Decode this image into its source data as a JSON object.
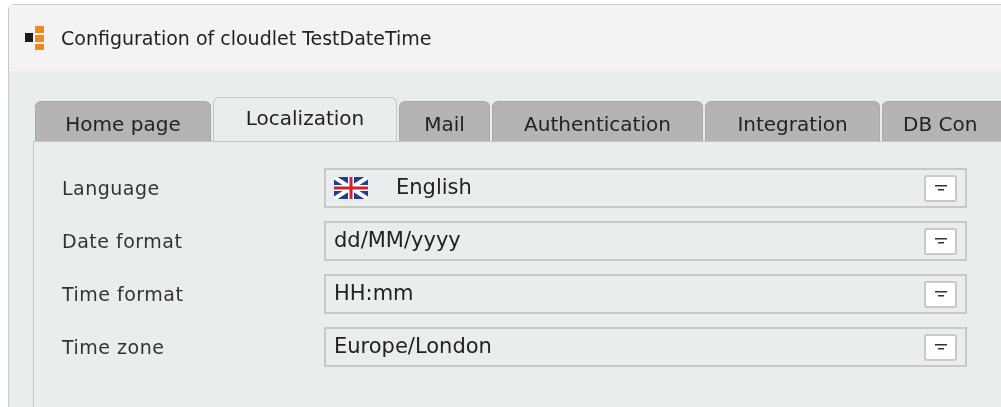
{
  "window": {
    "title": "Configuration of cloudlet TestDateTime"
  },
  "tabs": [
    {
      "label": "Home page",
      "selected": false
    },
    {
      "label": "Localization",
      "selected": true
    },
    {
      "label": "Mail",
      "selected": false
    },
    {
      "label": "Authentication",
      "selected": false
    },
    {
      "label": "Integration",
      "selected": false
    },
    {
      "label": "DB Con",
      "selected": false
    }
  ],
  "fields": [
    {
      "label": "Language",
      "kind": "flag",
      "value": "English"
    },
    {
      "label": "Date format",
      "kind": "plain",
      "value": "dd/MM/yyyy"
    },
    {
      "label": "Time format",
      "kind": "plain",
      "value": "HH:mm"
    },
    {
      "label": "Time zone",
      "kind": "plain",
      "value": "Europe/London"
    }
  ]
}
